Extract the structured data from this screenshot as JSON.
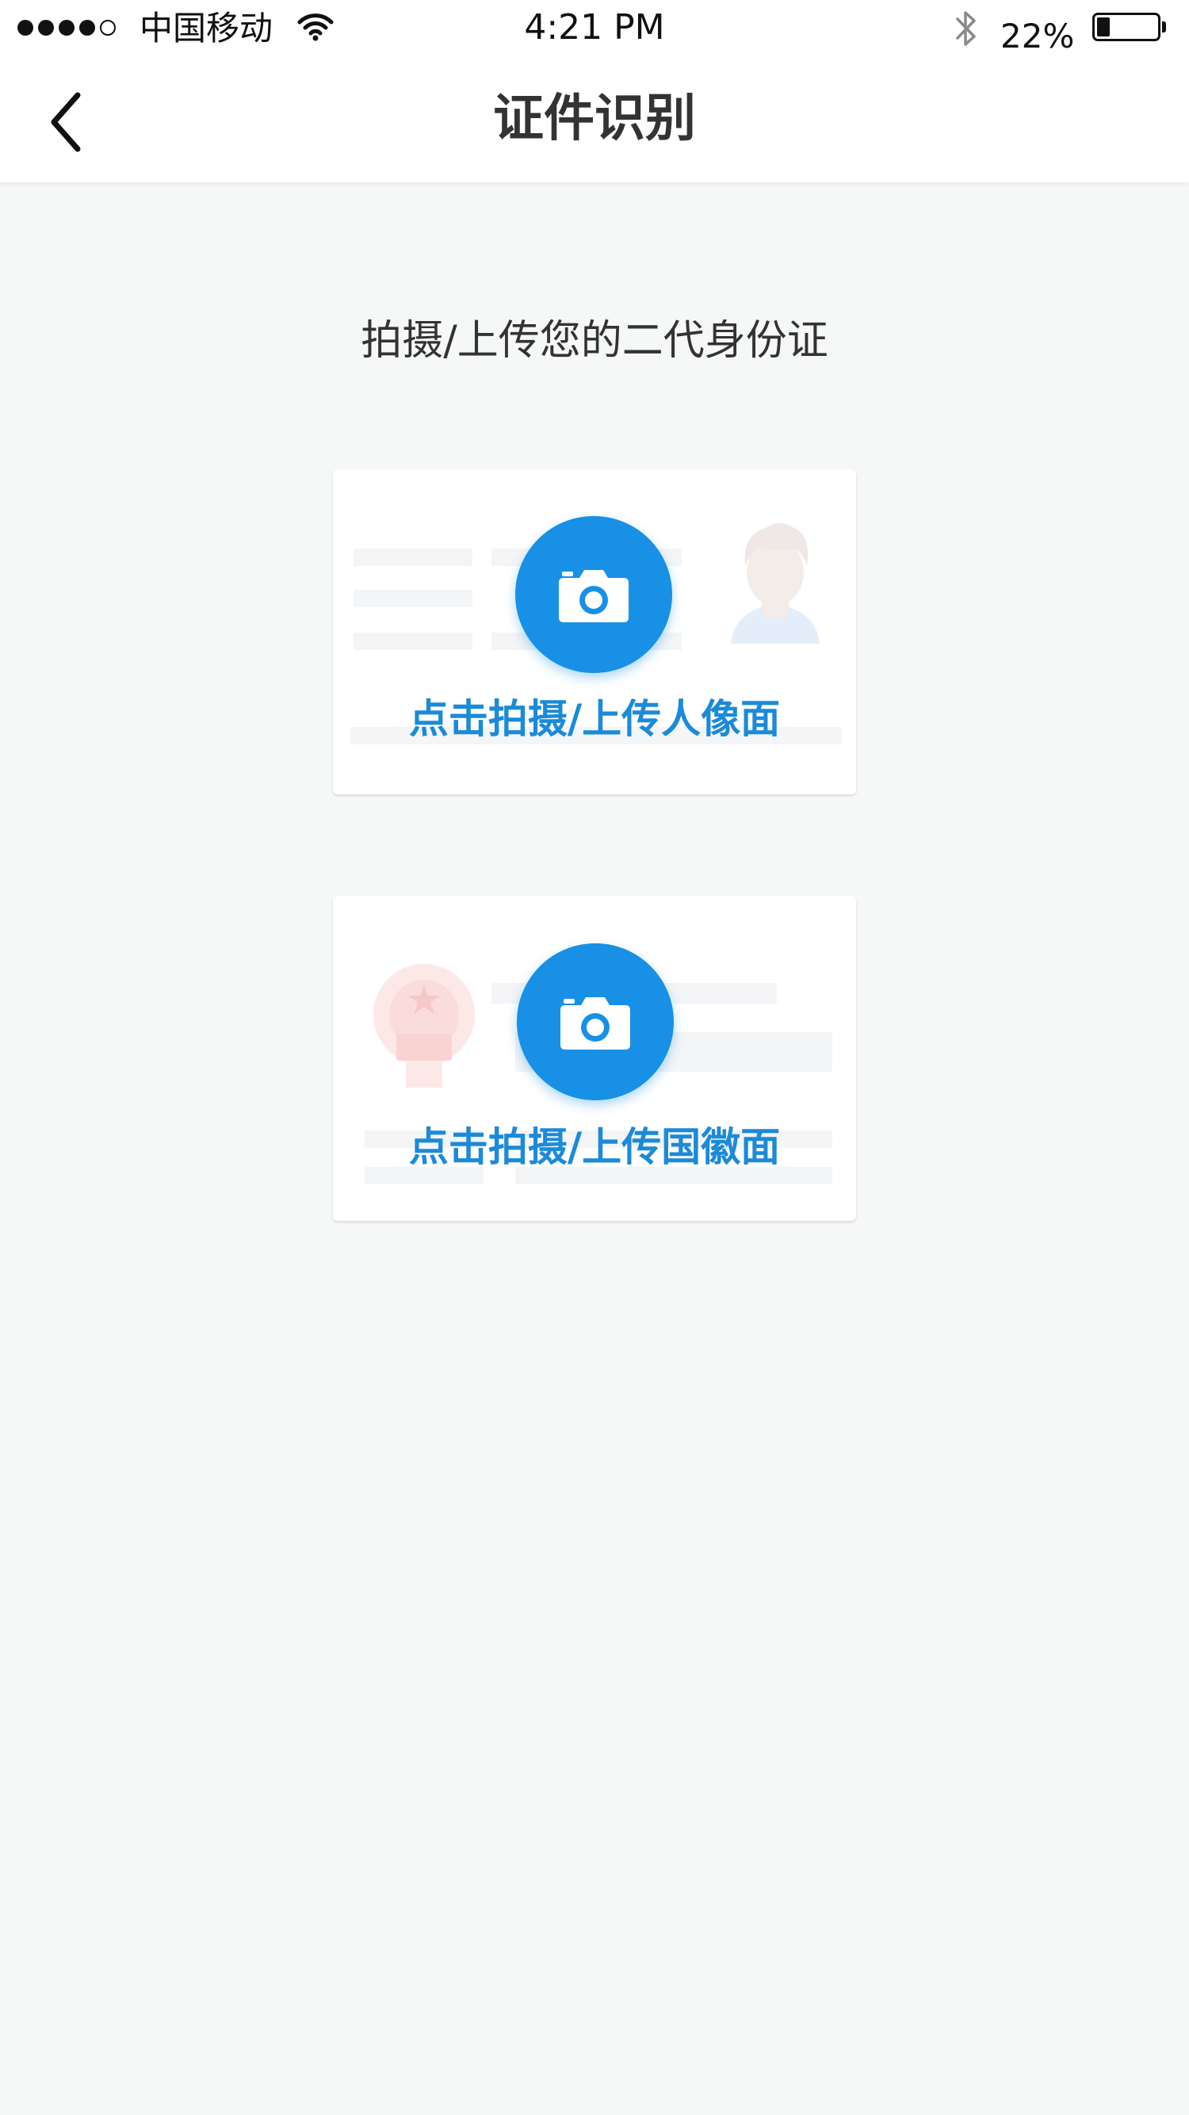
{
  "status_bar": {
    "carrier": "中国移动",
    "time": "4:21 PM",
    "battery_percent": "22%",
    "battery_level": 0.22,
    "signal_bars_filled": 4,
    "signal_bars_total": 5,
    "icons": [
      "signal-dots-icon",
      "wifi-icon",
      "bluetooth-icon",
      "battery-icon"
    ]
  },
  "nav": {
    "title": "证件识别",
    "back_icon": "chevron-left-icon"
  },
  "main": {
    "instruction": "拍摄/上传您的二代身份证",
    "cards": [
      {
        "label": "点击拍摄/上传人像面",
        "icon": "camera-icon",
        "illustration": "portrait-avatar-icon"
      },
      {
        "label": "点击拍摄/上传国徽面",
        "icon": "camera-icon",
        "illustration": "national-emblem-icon"
      }
    ]
  },
  "colors": {
    "accent": "#1890e6",
    "label_blue": "#1b8ad9",
    "page_background": "#f6f8f8",
    "title_text": "#333333"
  }
}
